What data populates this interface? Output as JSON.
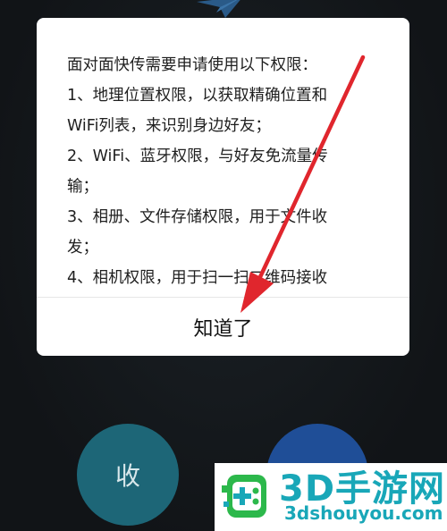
{
  "dialog": {
    "lines": [
      "面对面快传需要申请使用以下权限：",
      "1、地理位置权限，以获取精确位置和",
      "WiFi列表，来识别身边好友；",
      "2、WiFi、蓝牙权限，与好友免流量传",
      "输；",
      "3、相册、文件存储权限，用于文件收",
      "发；",
      "4、相机权限，用于扫一扫二维码接收"
    ],
    "ok_label": "知道了"
  },
  "buttons": {
    "receive_label": "收",
    "send_label": ""
  },
  "watermark": {
    "title": "3D手游网",
    "url": "3dshouyou.com"
  },
  "colors": {
    "background": "#15191d",
    "receive_button": "#1d6677",
    "send_button": "#1f4e97",
    "arrow": "#e0262d",
    "watermark": "#19a7b8"
  },
  "icons": {
    "top_icon": "paper-plane-icon",
    "annotation": "red-arrow-icon"
  }
}
